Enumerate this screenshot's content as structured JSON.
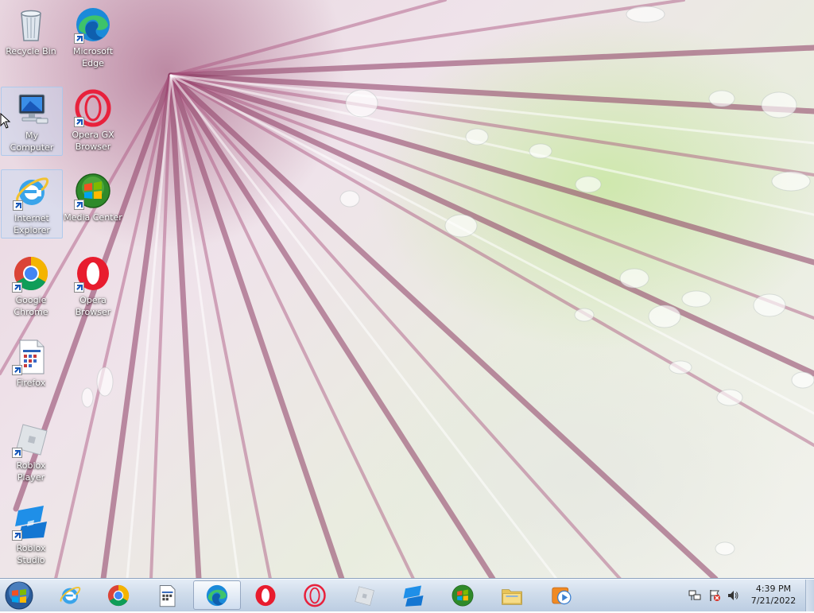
{
  "desktop": {
    "icons": [
      {
        "label": "Recycle Bin",
        "icon": "recycle-bin-icon",
        "shortcut": false,
        "selected": false
      },
      {
        "label": "Microsoft Edge",
        "icon": "edge-icon",
        "shortcut": true,
        "selected": false
      },
      {
        "label": "My Computer",
        "icon": "computer-icon",
        "shortcut": false,
        "selected": true
      },
      {
        "label": "Opera GX Browser",
        "icon": "opera-gx-icon",
        "shortcut": true,
        "selected": false
      },
      {
        "label": "Internet Explorer",
        "icon": "internet-explorer-icon",
        "shortcut": true,
        "selected": true
      },
      {
        "label": "Media Center",
        "icon": "media-center-icon",
        "shortcut": true,
        "selected": false
      },
      {
        "label": "Google Chrome",
        "icon": "chrome-icon",
        "shortcut": true,
        "selected": false
      },
      {
        "label": "Opera Browser",
        "icon": "opera-icon",
        "shortcut": true,
        "selected": false
      },
      {
        "label": "Firefox",
        "icon": "firefox-icon",
        "shortcut": true,
        "selected": false
      },
      {
        "label": "Roblox Player",
        "icon": "roblox-player-icon",
        "shortcut": true,
        "selected": false
      },
      {
        "label": "Roblox Studio",
        "icon": "roblox-studio-icon",
        "shortcut": true,
        "selected": false
      }
    ]
  },
  "taskbar": {
    "start": {
      "icon": "windows-start-icon"
    },
    "pinned": [
      {
        "icon": "internet-explorer-icon",
        "active": false
      },
      {
        "icon": "chrome-icon",
        "active": false
      },
      {
        "icon": "firefox-icon",
        "active": false
      },
      {
        "icon": "edge-icon",
        "active": true
      },
      {
        "icon": "opera-icon",
        "active": false
      },
      {
        "icon": "opera-gx-icon",
        "active": false
      },
      {
        "icon": "roblox-player-icon",
        "active": false
      },
      {
        "icon": "roblox-studio-icon",
        "active": false
      },
      {
        "icon": "media-center-icon",
        "active": false
      },
      {
        "icon": "file-explorer-icon",
        "active": false
      },
      {
        "icon": "media-player-icon",
        "active": false
      }
    ],
    "tray": {
      "icons": [
        "network-icon",
        "action-center-flag-icon",
        "volume-icon"
      ],
      "time": "4:39 PM",
      "date": "7/21/2022"
    }
  },
  "colors": {
    "taskbar_top": "#e4ecf6",
    "taskbar_bottom": "#bccde2",
    "selection": "#c8dcf5"
  }
}
